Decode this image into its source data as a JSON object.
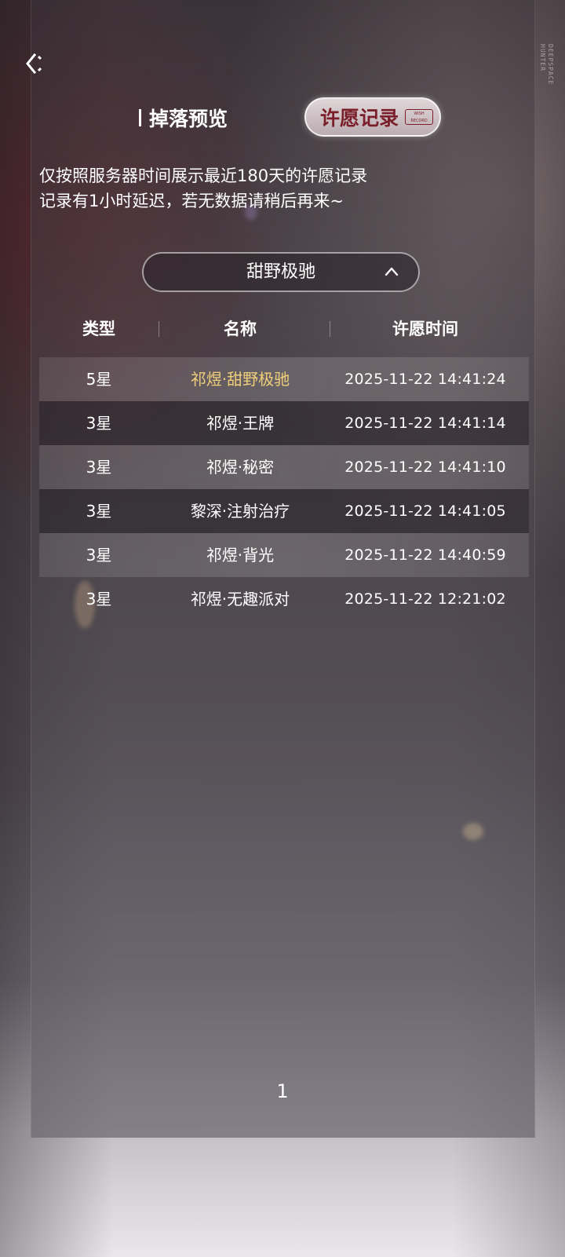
{
  "header": {
    "back_icon": "back-arrow-icon",
    "deco_label": "DEEPSPACE HUNTER"
  },
  "tabs": [
    {
      "label": "掉落预览",
      "active": false
    },
    {
      "label": "许愿记录",
      "active": true,
      "tag": "WISH RECORD"
    }
  ],
  "notice": {
    "line1": "仅按照服务器时间展示最近180天的许愿记录",
    "line2": "记录有1小时延迟，若无数据请稍后再来~"
  },
  "pool_select": {
    "value": "甜野极驰",
    "icon": "chevron-up-icon"
  },
  "table": {
    "headers": [
      "类型",
      "名称",
      "许愿时间"
    ],
    "rows": [
      {
        "type": "5星",
        "name": "祁煜·甜野极驰",
        "time": "2025-11-22 14:41:24",
        "highlight": true
      },
      {
        "type": "3星",
        "name": "祁煜·王牌",
        "time": "2025-11-22 14:41:14",
        "highlight": false
      },
      {
        "type": "3星",
        "name": "祁煜·秘密",
        "time": "2025-11-22 14:41:10",
        "highlight": false
      },
      {
        "type": "3星",
        "name": "黎深·注射治疗",
        "time": "2025-11-22 14:41:05",
        "highlight": false
      },
      {
        "type": "3星",
        "name": "祁煜·背光",
        "time": "2025-11-22 14:40:59",
        "highlight": false
      },
      {
        "type": "3星",
        "name": "祁煜·无趣派对",
        "time": "2025-11-22 12:21:02",
        "highlight": false
      }
    ]
  },
  "pagination": {
    "current": "1"
  },
  "colors": {
    "highlight_text": "#f0cf7a",
    "active_tab_text": "#7a1f2a"
  }
}
